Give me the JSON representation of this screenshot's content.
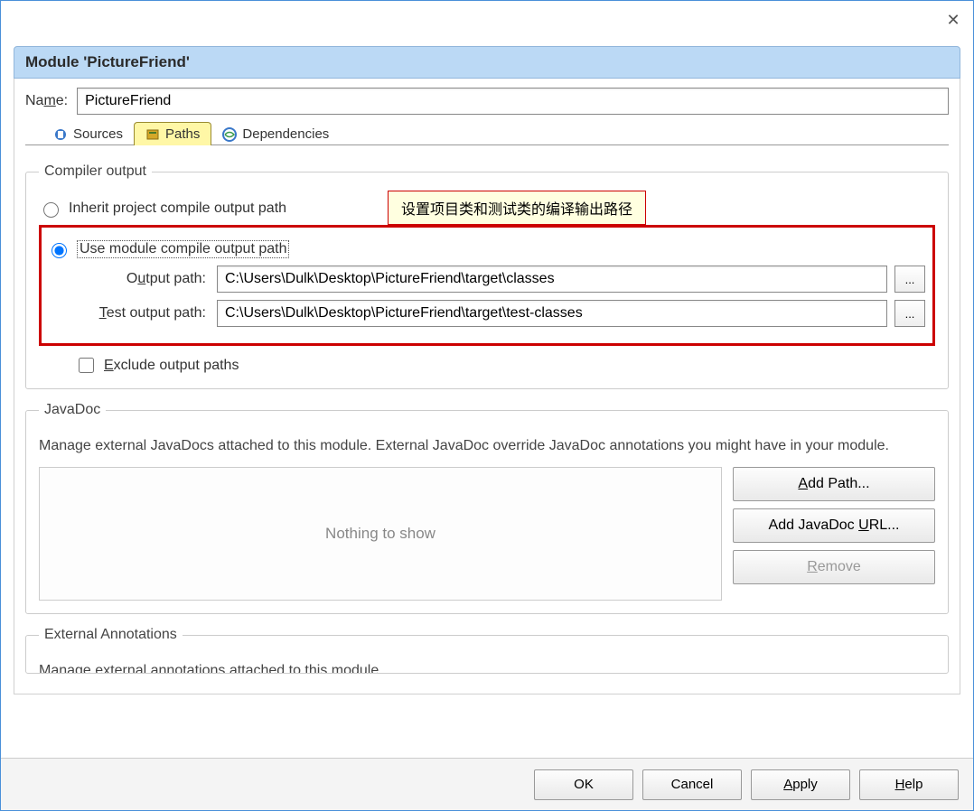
{
  "header": {
    "title": "Module 'PictureFriend'"
  },
  "name": {
    "label": "Name:",
    "value": "PictureFriend"
  },
  "tabs": {
    "sources": "Sources",
    "paths": "Paths",
    "dependencies": "Dependencies"
  },
  "compiler": {
    "legend": "Compiler output",
    "inherit": "Inherit project compile output path",
    "useModule": "Use module compile output path",
    "annotation": "设置项目类和测试类的编译输出路径",
    "outputLabel": "Output path:",
    "outputValue": "C:\\Users\\Dulk\\Desktop\\PictureFriend\\target\\classes",
    "testLabel": "Test output path:",
    "testValue": "C:\\Users\\Dulk\\Desktop\\PictureFriend\\target\\test-classes",
    "browse": "...",
    "exclude": "Exclude output paths"
  },
  "javadoc": {
    "legend": "JavaDoc",
    "desc": "Manage external JavaDocs attached to this module. External JavaDoc override JavaDoc annotations you might have in your module.",
    "empty": "Nothing to show",
    "addPath": "Add Path...",
    "addUrl": "Add JavaDoc URL...",
    "remove": "Remove"
  },
  "externalAnnotations": {
    "legend": "External Annotations",
    "desc": "Manage external annotations attached to this module."
  },
  "buttons": {
    "ok": "OK",
    "cancel": "Cancel",
    "apply": "Apply",
    "help": "Help"
  }
}
